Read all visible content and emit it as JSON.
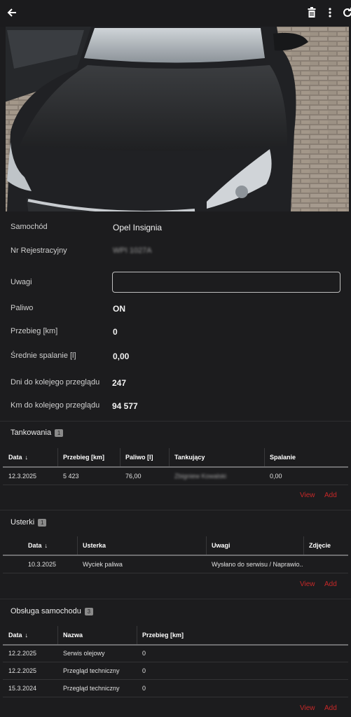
{
  "toolbar": {
    "back_icon": "arrow-left-icon",
    "delete_icon": "trash-icon",
    "more_icon": "more-vertical-icon",
    "refresh_icon": "refresh-icon"
  },
  "details": {
    "car_label": "Samochód",
    "car_value": "Opel Insignia",
    "reg_label": "Nr Rejestracyjny",
    "reg_value": "WPI 1027A",
    "notes_label": "Uwagi",
    "notes_value": "",
    "fuel_label": "Paliwo",
    "fuel_value": "ON",
    "mileage_label": "Przebieg [km]",
    "mileage_value": "0",
    "avg_label": "Średnie spalanie [l]",
    "avg_value": "0,00",
    "days_label": "Dni do kolejego przeglądu",
    "days_value": "247",
    "km_label": "Km do kolejego przeglądu",
    "km_value": "94 577"
  },
  "refuels": {
    "title": "Tankowania",
    "count": "1",
    "headers": [
      "Data",
      "Przebieg [km]",
      "Paliwo [l]",
      "Tankujący",
      "Spalanie"
    ],
    "rows": [
      {
        "date": "12.3.2025",
        "mileage": "5 423",
        "fuel": "76,00",
        "person": "Zbigniew Kowalski",
        "burn": "0,00"
      }
    ],
    "view": "View",
    "add": "Add"
  },
  "faults": {
    "title": "Usterki",
    "count": "1",
    "headers": [
      "Data",
      "Usterka",
      "Uwagi",
      "Zdjęcie"
    ],
    "rows": [
      {
        "date": "10.3.2025",
        "fault": "Wyciek paliwa",
        "notes": "Wysłano do serwisu / Naprawio..."
      }
    ],
    "view": "View",
    "add": "Add"
  },
  "service": {
    "title": "Obsługa samochodu",
    "count": "3",
    "headers": [
      "Data",
      "Nazwa",
      "Przebieg [km]"
    ],
    "rows": [
      {
        "date": "12.2.2025",
        "name": "Serwis olejowy",
        "mileage": "0"
      },
      {
        "date": "12.2.2025",
        "name": "Przegląd techniczny",
        "mileage": "0"
      },
      {
        "date": "15.3.2024",
        "name": "Przegląd techniczny",
        "mileage": "0"
      }
    ],
    "view": "View",
    "add": "Add"
  },
  "colors": {
    "background": "#1c1c1e",
    "accent_red": "#c62828"
  }
}
